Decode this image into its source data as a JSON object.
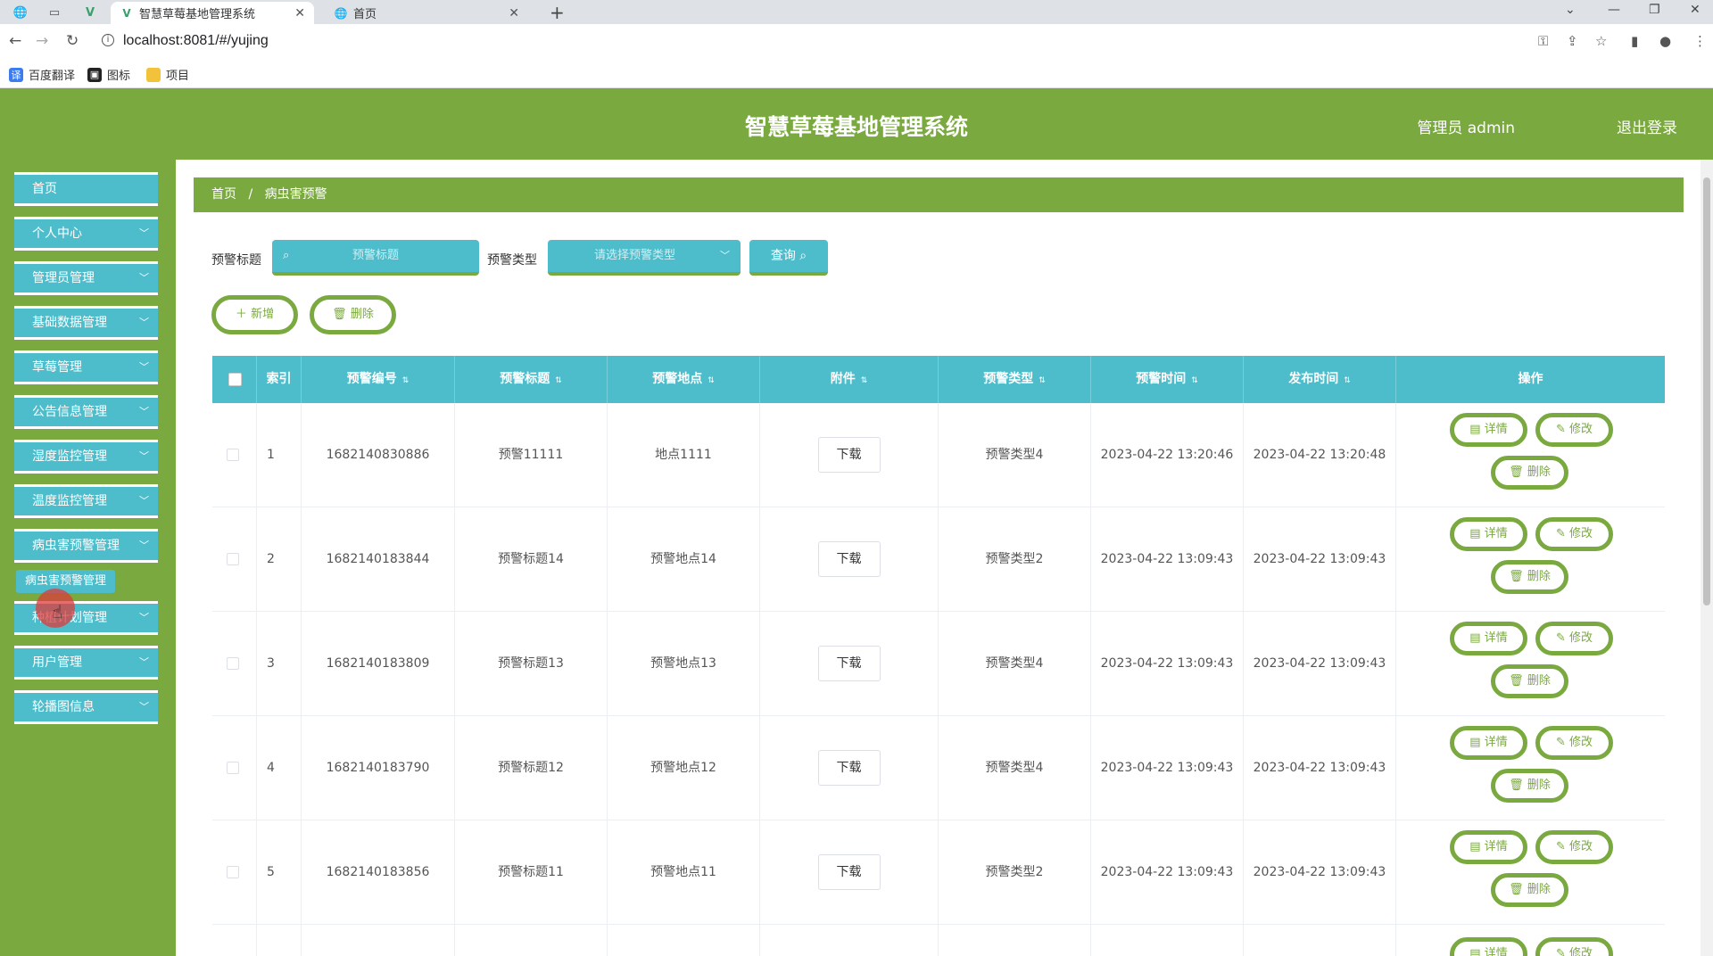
{
  "browser": {
    "tabs": [
      {
        "title": "智慧草莓基地管理系统",
        "active": true
      },
      {
        "title": "首页",
        "active": false
      }
    ],
    "url": "localhost:8081/#/yujing",
    "bookmarks": [
      "百度翻译",
      "图标",
      "项目"
    ]
  },
  "header": {
    "title": "智慧草莓基地管理系统",
    "admin": "管理员 admin",
    "logout": "退出登录",
    "colors": {
      "green": "#7aa93f",
      "teal": "#4dbdcc"
    }
  },
  "sidebar": {
    "items": [
      {
        "label": "首页",
        "has_arrow": false
      },
      {
        "label": "个人中心",
        "has_arrow": true
      },
      {
        "label": "管理员管理",
        "has_arrow": true
      },
      {
        "label": "基础数据管理",
        "has_arrow": true
      },
      {
        "label": "草莓管理",
        "has_arrow": true
      },
      {
        "label": "公告信息管理",
        "has_arrow": true
      },
      {
        "label": "湿度监控管理",
        "has_arrow": true
      },
      {
        "label": "温度监控管理",
        "has_arrow": true
      },
      {
        "label": "病虫害预警管理",
        "has_arrow": true
      },
      {
        "label": "种植计划管理",
        "has_arrow": true
      },
      {
        "label": "用户管理",
        "has_arrow": true
      },
      {
        "label": "轮播图信息",
        "has_arrow": true
      }
    ],
    "tooltip": "病虫害预警管理"
  },
  "breadcrumb": {
    "home": "首页",
    "separator": "/",
    "current": "病虫害预警"
  },
  "search": {
    "title_label": "预警标题",
    "title_placeholder": "预警标题",
    "type_label": "预警类型",
    "type_placeholder": "请选择预警类型",
    "query_label": "查询"
  },
  "actions": {
    "add": "新增",
    "delete": "删除"
  },
  "table": {
    "headers": [
      "索引",
      "预警编号",
      "预警标题",
      "预警地点",
      "附件",
      "预警类型",
      "预警时间",
      "发布时间",
      "操作"
    ],
    "download_label": "下载",
    "op_detail": "详情",
    "op_edit": "修改",
    "op_delete": "删除",
    "rows": [
      {
        "index": "1",
        "code": "1682140830886",
        "title": "预警11111",
        "place": "地点1111",
        "type": "预警类型4",
        "warn_time": "2023-04-22 13:20:46",
        "publish_time": "2023-04-22 13:20:48"
      },
      {
        "index": "2",
        "code": "1682140183844",
        "title": "预警标题14",
        "place": "预警地点14",
        "type": "预警类型2",
        "warn_time": "2023-04-22 13:09:43",
        "publish_time": "2023-04-22 13:09:43"
      },
      {
        "index": "3",
        "code": "1682140183809",
        "title": "预警标题13",
        "place": "预警地点13",
        "type": "预警类型4",
        "warn_time": "2023-04-22 13:09:43",
        "publish_time": "2023-04-22 13:09:43"
      },
      {
        "index": "4",
        "code": "1682140183790",
        "title": "预警标题12",
        "place": "预警地点12",
        "type": "预警类型4",
        "warn_time": "2023-04-22 13:09:43",
        "publish_time": "2023-04-22 13:09:43"
      },
      {
        "index": "5",
        "code": "1682140183856",
        "title": "预警标题11",
        "place": "预警地点11",
        "type": "预警类型2",
        "warn_time": "2023-04-22 13:09:43",
        "publish_time": "2023-04-22 13:09:43"
      }
    ]
  }
}
